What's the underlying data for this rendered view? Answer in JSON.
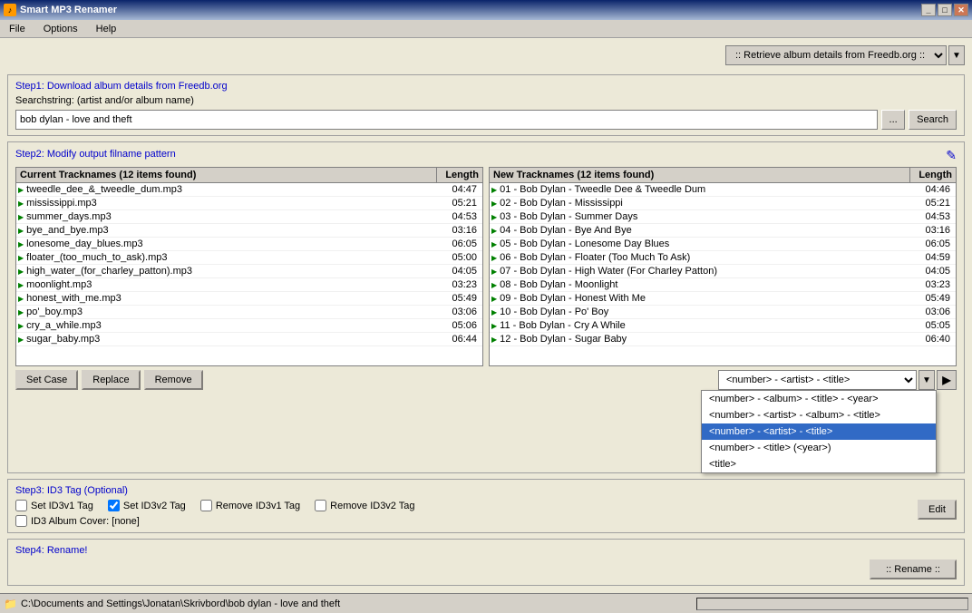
{
  "window": {
    "title": "Smart MP3 Renamer",
    "icon": "♪"
  },
  "menu": {
    "items": [
      "File",
      "Options",
      "Help"
    ]
  },
  "retrieve": {
    "label": ":: Retrieve album details from Freedb.org ::",
    "arrow": "▼"
  },
  "step1": {
    "label": "Step1: Download album details from Freedb.org",
    "search_label": "Searchstring: (artist and/or album name)",
    "search_value": "bob dylan - love and theft",
    "browse_label": "...",
    "search_button": "Search"
  },
  "step2": {
    "label": "Step2: Modify output filname pattern",
    "edit_icon": "✎",
    "current_tracks": {
      "header": "Current Tracknames (12 items found)",
      "length_header": "Length",
      "items": [
        {
          "name": "tweedle_dee_&_tweedle_dum.mp3",
          "length": "04:47"
        },
        {
          "name": "mississippi.mp3",
          "length": "05:21"
        },
        {
          "name": "summer_days.mp3",
          "length": "04:53"
        },
        {
          "name": "bye_and_bye.mp3",
          "length": "03:16"
        },
        {
          "name": "lonesome_day_blues.mp3",
          "length": "06:05"
        },
        {
          "name": "floater_(too_much_to_ask).mp3",
          "length": "05:00"
        },
        {
          "name": "high_water_(for_charley_patton).mp3",
          "length": "04:05"
        },
        {
          "name": "moonlight.mp3",
          "length": "03:23"
        },
        {
          "name": "honest_with_me.mp3",
          "length": "05:49"
        },
        {
          "name": "po'_boy.mp3",
          "length": "03:06"
        },
        {
          "name": "cry_a_while.mp3",
          "length": "05:06"
        },
        {
          "name": "sugar_baby.mp3",
          "length": "06:44"
        }
      ]
    },
    "new_tracks": {
      "header": "New Tracknames (12 items found)",
      "length_header": "Length",
      "items": [
        {
          "name": "01 - Bob Dylan - Tweedle Dee & Tweedle Dum",
          "length": "04:46"
        },
        {
          "name": "02 - Bob Dylan - Mississippi",
          "length": "05:21"
        },
        {
          "name": "03 - Bob Dylan - Summer Days",
          "length": "04:53"
        },
        {
          "name": "04 - Bob Dylan - Bye And Bye",
          "length": "03:16"
        },
        {
          "name": "05 - Bob Dylan - Lonesome Day Blues",
          "length": "06:05"
        },
        {
          "name": "06 - Bob Dylan - Floater (Too Much To Ask)",
          "length": "04:59"
        },
        {
          "name": "07 - Bob Dylan - High Water (For Charley Patton)",
          "length": "04:05"
        },
        {
          "name": "08 - Bob Dylan - Moonlight",
          "length": "03:23"
        },
        {
          "name": "09 - Bob Dylan - Honest With Me",
          "length": "05:49"
        },
        {
          "name": "10 - Bob Dylan - Po' Boy",
          "length": "03:06"
        },
        {
          "name": "11 - Bob Dylan - Cry A While",
          "length": "05:05"
        },
        {
          "name": "12 - Bob Dylan - Sugar Baby",
          "length": "06:40"
        }
      ]
    }
  },
  "buttons": {
    "set_case": "Set Case",
    "replace": "Replace",
    "remove": "Remove"
  },
  "pattern": {
    "current": "<number> - <artist> - <title>",
    "options": [
      "<number> - <album> - <title> - <year>",
      "<number> - <artist> - <album> - <title>",
      "<number> - <artist> - <title>",
      "<number> - <title> (<year>)",
      "<title>"
    ],
    "arrow": "▼",
    "go": "▶"
  },
  "step3": {
    "label": "Step3: ID3 Tag (Optional)",
    "checkboxes": [
      {
        "label": "Set ID3v1 Tag",
        "checked": false
      },
      {
        "label": "Set ID3v2 Tag",
        "checked": true
      },
      {
        "label": "Remove ID3v1 Tag",
        "checked": false
      },
      {
        "label": "Remove ID3v2 Tag",
        "checked": false
      }
    ],
    "album_cover": "ID3 Album Cover: [none]",
    "edit_button": "Edit"
  },
  "step4": {
    "label": "Step4: Rename!",
    "rename_button": ":: Rename ::"
  },
  "status": {
    "icon": "📁",
    "path": "C:\\Documents and Settings\\Jonatan\\Skrivbord\\bob dylan - love and theft"
  }
}
